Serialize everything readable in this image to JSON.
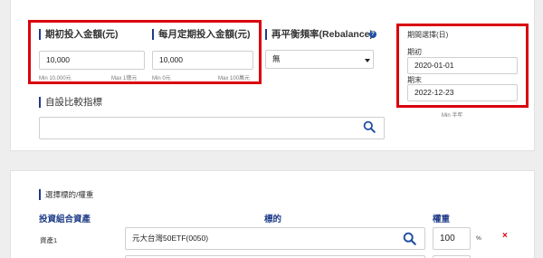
{
  "settings": {
    "initial_amount": {
      "label": "期初投入金額(元)",
      "value": "10,000",
      "min": "Min 10,000元",
      "max": "Max 1億元"
    },
    "periodic_amount": {
      "label": "每月定期投入金額(元)",
      "value": "10,000",
      "min": "Min 0元",
      "max": "Max 100萬元"
    },
    "rebalance": {
      "label": "再平衡頻率(Rebalance)",
      "help": "?",
      "value": "無"
    },
    "benchmark": {
      "label": "自設比較指標",
      "value": ""
    },
    "period": {
      "title": "期間選擇(日)",
      "start_label": "期初",
      "start_value": "2020-01-01",
      "end_label": "期末",
      "end_value": "2022-12-23",
      "min_note": "Min 半年"
    }
  },
  "portfolio": {
    "section_label": "選擇標的/權重",
    "headers": {
      "asset": "投資組合資產",
      "target": "標的",
      "weight": "權重"
    },
    "rows": [
      {
        "name": "資產1",
        "target": "元大台灣50ETF(0050)",
        "weight": "100",
        "unit": "%",
        "remove": "×"
      }
    ]
  },
  "colors": {
    "accent": "#1f3c88",
    "highlight": "#d9000d",
    "search": "#1f4fa0"
  }
}
